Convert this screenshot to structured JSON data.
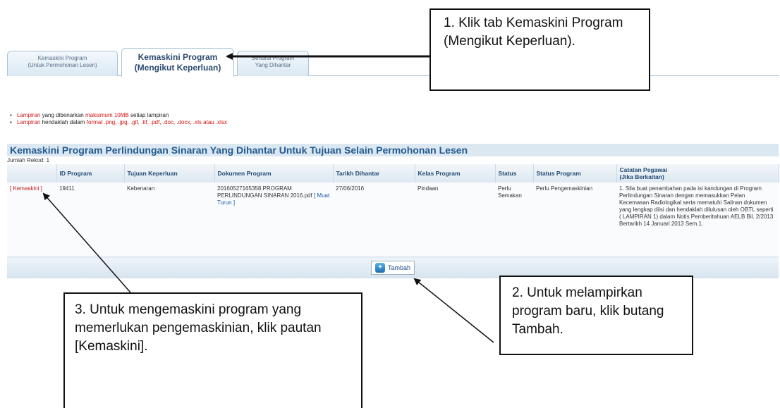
{
  "tabs": [
    {
      "line1": "Kemaskini Program",
      "line2": "(Untuk Permohonan Lesen)"
    },
    {
      "line1": "Kemaskini Program",
      "line2": "(Mengikut Keperluan)"
    },
    {
      "line1": "Senarai Program",
      "line2": "Yang Dihantar"
    }
  ],
  "notes": [
    {
      "highlight": "Lampiran",
      "text_a": " yang dibenarkan ",
      "highlight2": "maksimum 10MB",
      "text_b": " setiap lampiran"
    },
    {
      "highlight": "Lampiran",
      "text_a": " hendaklah dalam ",
      "highlight2": "format .png, .jpg, .gif, .tif, .pdf, .doc, .docx, .xls atau .xlsx",
      "text_b": ""
    }
  ],
  "section_title": "Kemaskini Program Perlindungan Sinaran Yang Dihantar Untuk Tujuan Selain Permohonan Lesen",
  "record_count": "Jumlah Rekod: 1",
  "table": {
    "headers": [
      "",
      "ID Program",
      "Tujuan Keperluan",
      "Dokumen Program",
      "Tarikh Dihantar",
      "Kelas Program",
      "Status",
      "Status Program",
      "Catatan Pegawai"
    ],
    "header_note": "(Jika Berkaitan)",
    "row": {
      "action": "[ Kemaskini ]",
      "id": "19411",
      "purpose": "Kebenaran",
      "document": "20160527165358.PROGRAM PERLINDUNGAN SINARAN 2016.pdf",
      "download": "[ Muat Turun ]",
      "date": "27/06/2016",
      "class": "Pindaan",
      "status": "Perlu Semakan",
      "program_status": "Perlu Pengemaskinian",
      "remark": "1. Sila buat penambahan pada isi kandungan di Program Perlindungan Sinaran dengan memasukkan Pelan Kecemasan Radiologikal serta mematuhi Salinan dokumen yang lengkap diisi dan hendaklah dilulusan oleh OBTL seperti ( LAMPIRAN 1) dalam Notis Pemberitahuan AELB Bil. 2/2013 Bertarikh 14 Januari 2013 Sem.1."
    },
    "add_label": "Tambah"
  },
  "callouts": {
    "c1": "1. Klik tab Kemaskini Program (Mengikut Keperluan).",
    "c2": "2. Untuk melampirkan program baru, klik butang Tambah.",
    "c3": "3. Untuk mengemaskini program yang memerlukan pengemaskinian, klik pautan [Kemaskini]."
  },
  "colors": {
    "accent": "#235a8f",
    "warning": "#d21414"
  }
}
